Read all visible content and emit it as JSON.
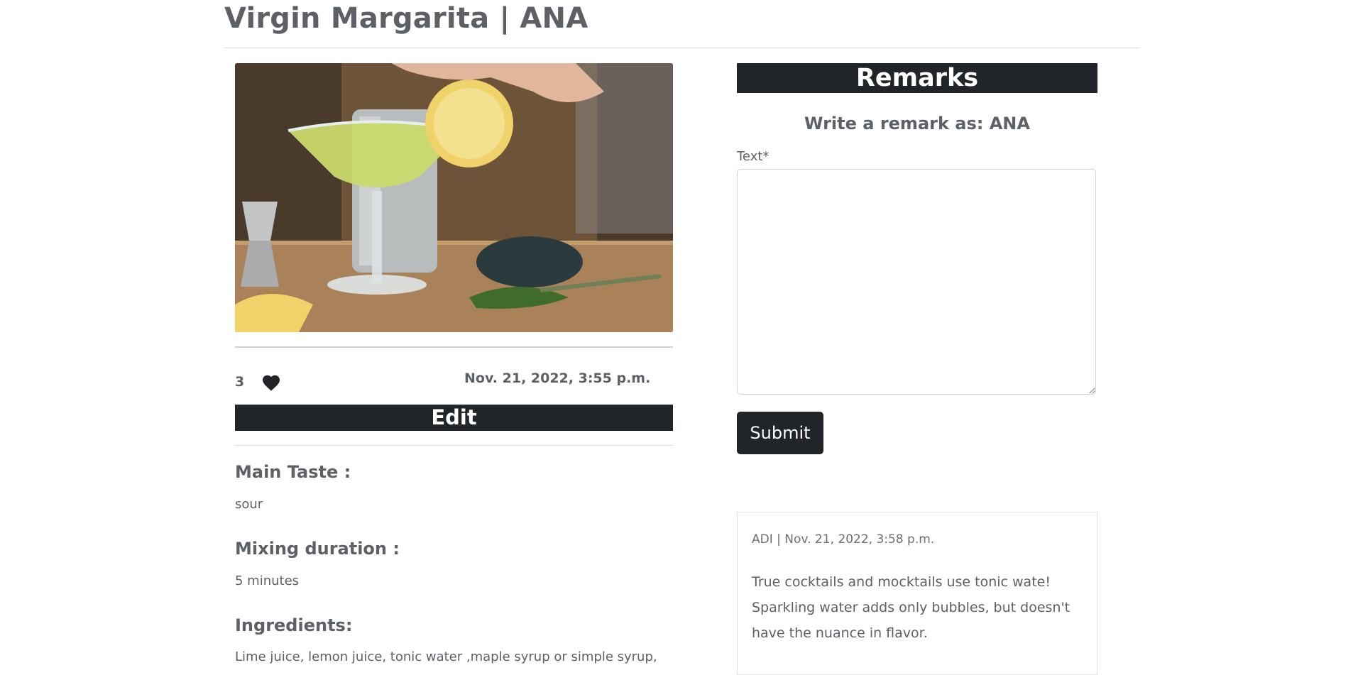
{
  "page": {
    "title": "Virgin Margarita | ANA"
  },
  "post": {
    "like_count": "3",
    "date": "Nov. 21, 2022, 3:55 p.m.",
    "edit_label": "Edit",
    "fields": [
      {
        "label": "Main Taste :",
        "value": "sour"
      },
      {
        "label": "Mixing duration :",
        "value": "5 minutes"
      },
      {
        "label": "Ingredients:",
        "value": "Lime juice, lemon juice, tonic water ,maple syrup or simple syrup,"
      }
    ]
  },
  "remarks": {
    "heading": "Remarks",
    "write_as": "Write a remark as: ANA",
    "text_label": "Text*",
    "text_value": "",
    "submit_label": "Submit",
    "comments": [
      {
        "meta": "ADI | Nov. 21, 2022, 3:58 p.m.",
        "text": "True cocktails and mocktails use tonic wate! Sparkling water adds only bubbles, but doesn't have the nuance in flavor."
      }
    ]
  },
  "colors": {
    "dark": "#212529",
    "text": "#5d6166"
  },
  "icons": {
    "like": "heart-icon"
  }
}
